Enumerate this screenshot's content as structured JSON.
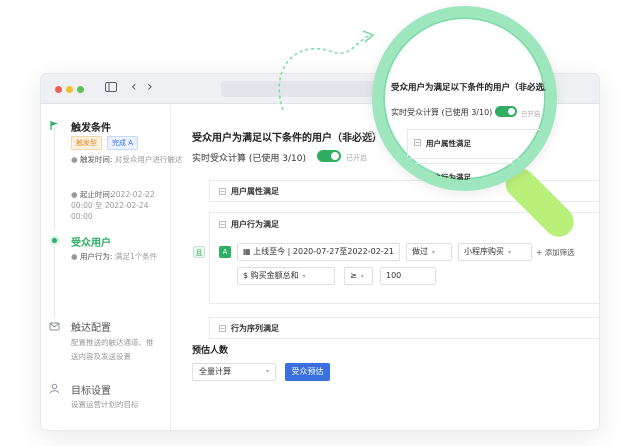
{
  "window": {
    "nav_back": "‹",
    "nav_forward": "›"
  },
  "sidebar": {
    "steps": [
      {
        "title": "触发条件",
        "tag_type": "触发型",
        "tag_status": "完成 A",
        "trigger_time_label": "触发时间:",
        "trigger_time_value": "对受众用户进行触达",
        "range_label": "起止时间:",
        "range_value": "2022-02-22 00:00 至 2022-02-24 00:00"
      },
      {
        "title": "受众用户",
        "behavior_label": "用户行为:",
        "behavior_value": "满足1个条件"
      },
      {
        "title": "触达配置",
        "desc_line1": "配置推送的触达通道、推",
        "desc_line2": "送内容及发送设置"
      },
      {
        "title": "目标设置",
        "desc_line1": "设置运营计划的目标"
      }
    ]
  },
  "main": {
    "title": "受众用户为满足以下条件的用户（非必选）",
    "realtime_label": "实时受众计算 (已使用 3/10)",
    "realtime_status": "已开启",
    "groups": {
      "attribute": "用户属性满足",
      "behavior": "用户行为满足",
      "sequence": "行为序列满足"
    },
    "and_badge": "且",
    "rule_badge": "A",
    "rule": {
      "date": "上线至今 | 2020-07-27至2022-02-21",
      "op": "做过",
      "event": "小程序购买",
      "add_filter": "+ 添加筛选",
      "metric": "$ 购买金额总和",
      "comparator": "≥",
      "value": "100"
    },
    "estimate_label": "预估人数",
    "estimate_select": "全量计算",
    "estimate_button": "受众预估"
  },
  "magnifier": {
    "title": "受众用户为满足以下条件的用户（非必选）",
    "realtime_label": "实时受众计算 (已使用 3/10)",
    "realtime_status": "已开启",
    "attribute": "用户属性满足",
    "behavior": "用户行为满足"
  },
  "colors": {
    "accent_green": "#2dae62",
    "primary_blue": "#3a6fe0",
    "lens_green": "#9ee6bd",
    "handle_green": "#b9f07a"
  }
}
